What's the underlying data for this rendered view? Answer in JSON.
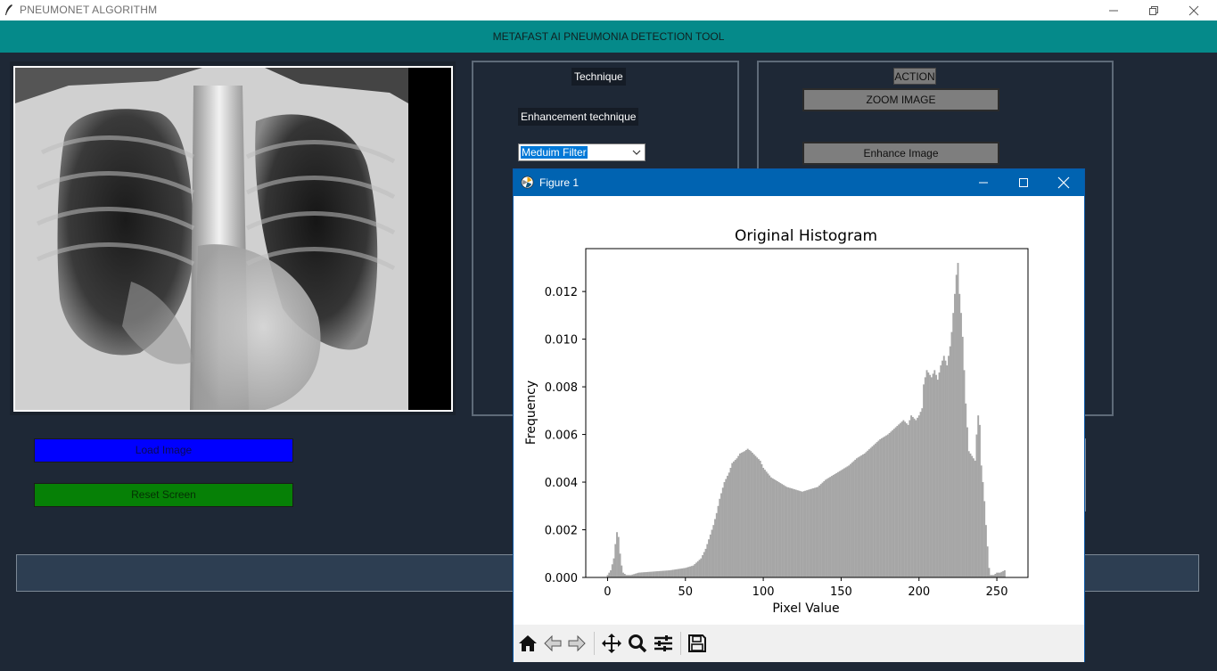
{
  "window": {
    "title": "PNEUMONET ALGORITHM",
    "header_title": "METAFAST AI PNEUMONIA DETECTION TOOL"
  },
  "technique_panel": {
    "title": "Technique",
    "enhancement_label": "Enhancement technique",
    "select_value": "Meduim Filter"
  },
  "action_panel": {
    "title": "ACTION",
    "zoom_button": "ZOOM IMAGE",
    "enhance_button": "Enhance Image"
  },
  "buttons": {
    "load": "Load Image",
    "reset": "Reset Screen"
  },
  "figure": {
    "window_title": "Figure 1",
    "toolbar_icons": [
      "home-icon",
      "back-arrow-icon",
      "forward-arrow-icon",
      "pan-icon",
      "zoom-icon",
      "configure-subplots-icon",
      "save-icon"
    ]
  },
  "colors": {
    "header": "#058a8a",
    "background": "#1e2836",
    "load_button": "#0000ff",
    "reset_button": "#068006",
    "histogram_bars": "#a6a6a6",
    "figure_titlebar": "#0063b1"
  },
  "chart_data": {
    "type": "bar",
    "title": "Original Histogram",
    "xlabel": "Pixel Value",
    "ylabel": "Frequency",
    "xlim": [
      -14,
      270
    ],
    "ylim": [
      0,
      0.0138
    ],
    "xticks": [
      "0",
      "50",
      "100",
      "150",
      "200",
      "250"
    ],
    "xtick_values": [
      0,
      50,
      100,
      150,
      200,
      250
    ],
    "yticks": [
      "0.000",
      "0.002",
      "0.004",
      "0.006",
      "0.008",
      "0.010",
      "0.012"
    ],
    "ytick_values": [
      0,
      0.002,
      0.004,
      0.006,
      0.008,
      0.01,
      0.012
    ],
    "profile_x": [
      0,
      2,
      4,
      5,
      6,
      7,
      8,
      9,
      10,
      12,
      15,
      20,
      30,
      40,
      45,
      50,
      55,
      60,
      63,
      65,
      68,
      70,
      72,
      75,
      78,
      80,
      83,
      85,
      88,
      90,
      92,
      95,
      98,
      100,
      105,
      110,
      115,
      120,
      125,
      130,
      135,
      140,
      145,
      150,
      155,
      160,
      165,
      170,
      175,
      180,
      185,
      190,
      193,
      195,
      198,
      200,
      202,
      203,
      205,
      208,
      210,
      212,
      214,
      216,
      218,
      220,
      221,
      222,
      223,
      224,
      225,
      226,
      227,
      228,
      230,
      232,
      234,
      236,
      237,
      238,
      239,
      240,
      241,
      242,
      243,
      244,
      245,
      246,
      248,
      250,
      252,
      255
    ],
    "profile_y": [
      0.0001,
      0.0003,
      0.0008,
      0.0014,
      0.0019,
      0.0017,
      0.001,
      0.0005,
      0.0002,
      0.0001,
      0.0001,
      0.0002,
      0.00025,
      0.0003,
      0.00035,
      0.0004,
      0.0005,
      0.0008,
      0.0012,
      0.0016,
      0.0022,
      0.0027,
      0.0033,
      0.004,
      0.0044,
      0.0048,
      0.005,
      0.0052,
      0.0053,
      0.0054,
      0.0053,
      0.0051,
      0.0049,
      0.0046,
      0.0042,
      0.004,
      0.0038,
      0.0037,
      0.0036,
      0.0037,
      0.0038,
      0.0041,
      0.0043,
      0.0045,
      0.0047,
      0.005,
      0.0052,
      0.0055,
      0.0058,
      0.006,
      0.0063,
      0.0066,
      0.0064,
      0.0068,
      0.0066,
      0.0068,
      0.0071,
      0.0081,
      0.0087,
      0.0084,
      0.0087,
      0.0083,
      0.0089,
      0.0093,
      0.0089,
      0.0097,
      0.0103,
      0.0111,
      0.0119,
      0.0127,
      0.0132,
      0.0119,
      0.0111,
      0.0101,
      0.0073,
      0.0053,
      0.0051,
      0.0049,
      0.006,
      0.0068,
      0.0064,
      0.0047,
      0.004,
      0.0032,
      0.0022,
      0.0013,
      0.0004,
      0.0001,
      0.0001,
      0.0002,
      0.0002,
      0.0003
    ]
  }
}
